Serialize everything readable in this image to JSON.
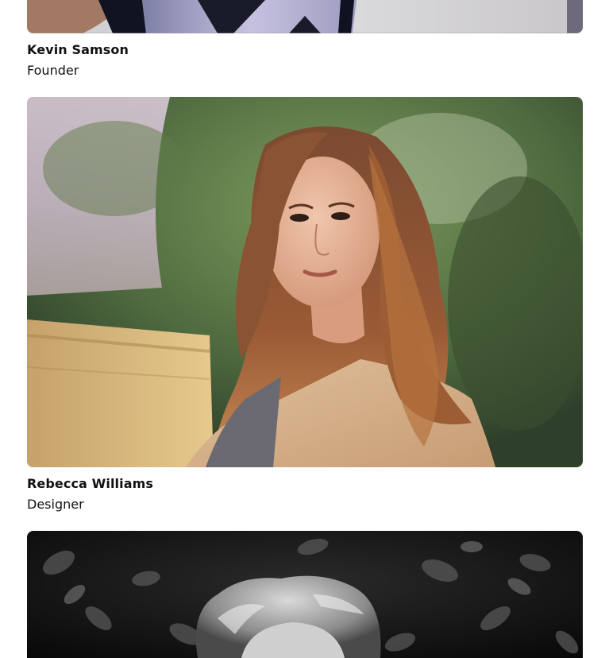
{
  "team": {
    "members": [
      {
        "name": "Kevin Samson",
        "role": "Founder",
        "photo": "portrait-photo-man"
      },
      {
        "name": "Rebecca Williams",
        "role": "Designer",
        "photo": "portrait-photo-woman"
      },
      {
        "name": "",
        "role": "",
        "photo": "portrait-photo-bw"
      }
    ]
  }
}
